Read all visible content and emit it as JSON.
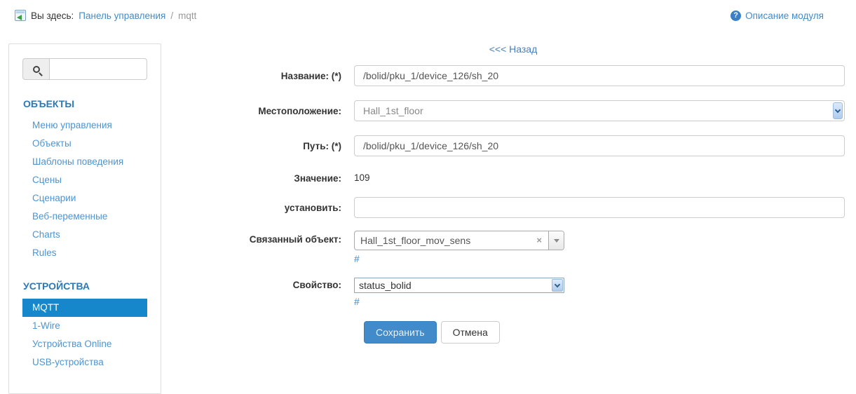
{
  "colors": {
    "accent": "#428bca",
    "sidebar_active_bg": "#1787cb",
    "save_button_bg": "#428bca"
  },
  "breadcrumb": {
    "you_are_here": "Вы здесь:",
    "home_link": "Панель управления",
    "separator": "/",
    "current": "mqtt"
  },
  "header": {
    "module_help_label": "Описание модуля",
    "help_icon_glyph": "?"
  },
  "sidebar": {
    "sections": [
      {
        "title": "ОБЪЕКТЫ",
        "items": [
          {
            "label": "Меню управления"
          },
          {
            "label": "Объекты"
          },
          {
            "label": "Шаблоны поведения"
          },
          {
            "label": "Сцены"
          },
          {
            "label": "Сценарии"
          },
          {
            "label": "Веб-переменные"
          },
          {
            "label": "Charts"
          },
          {
            "label": "Rules"
          }
        ]
      },
      {
        "title": "УСТРОЙСТВА",
        "items": [
          {
            "label": "MQTT",
            "active": true
          },
          {
            "label": "1-Wire"
          },
          {
            "label": "Устройства Online"
          },
          {
            "label": "USB-устройства"
          }
        ]
      }
    ]
  },
  "form": {
    "back_link": "<<< Назад",
    "name_label": "Название: (*)",
    "name_value": "/bolid/pku_1/device_126/sh_20",
    "location_label": "Местоположение:",
    "location_value": "Hall_1st_floor",
    "path_label": "Путь: (*)",
    "path_value": "/bolid/pku_1/device_126/sh_20",
    "value_label": "Значение:",
    "value": "109",
    "set_label": "установить:",
    "set_value": "",
    "linked_object_label": "Связанный объект:",
    "linked_object_value": "Hall_1st_floor_mov_sens",
    "linked_object_clear_glyph": "×",
    "linked_object_hash": "#",
    "property_label": "Свойство:",
    "property_value": "status_bolid",
    "property_hash": "#",
    "save_label": "Сохранить",
    "cancel_label": "Отмена"
  }
}
